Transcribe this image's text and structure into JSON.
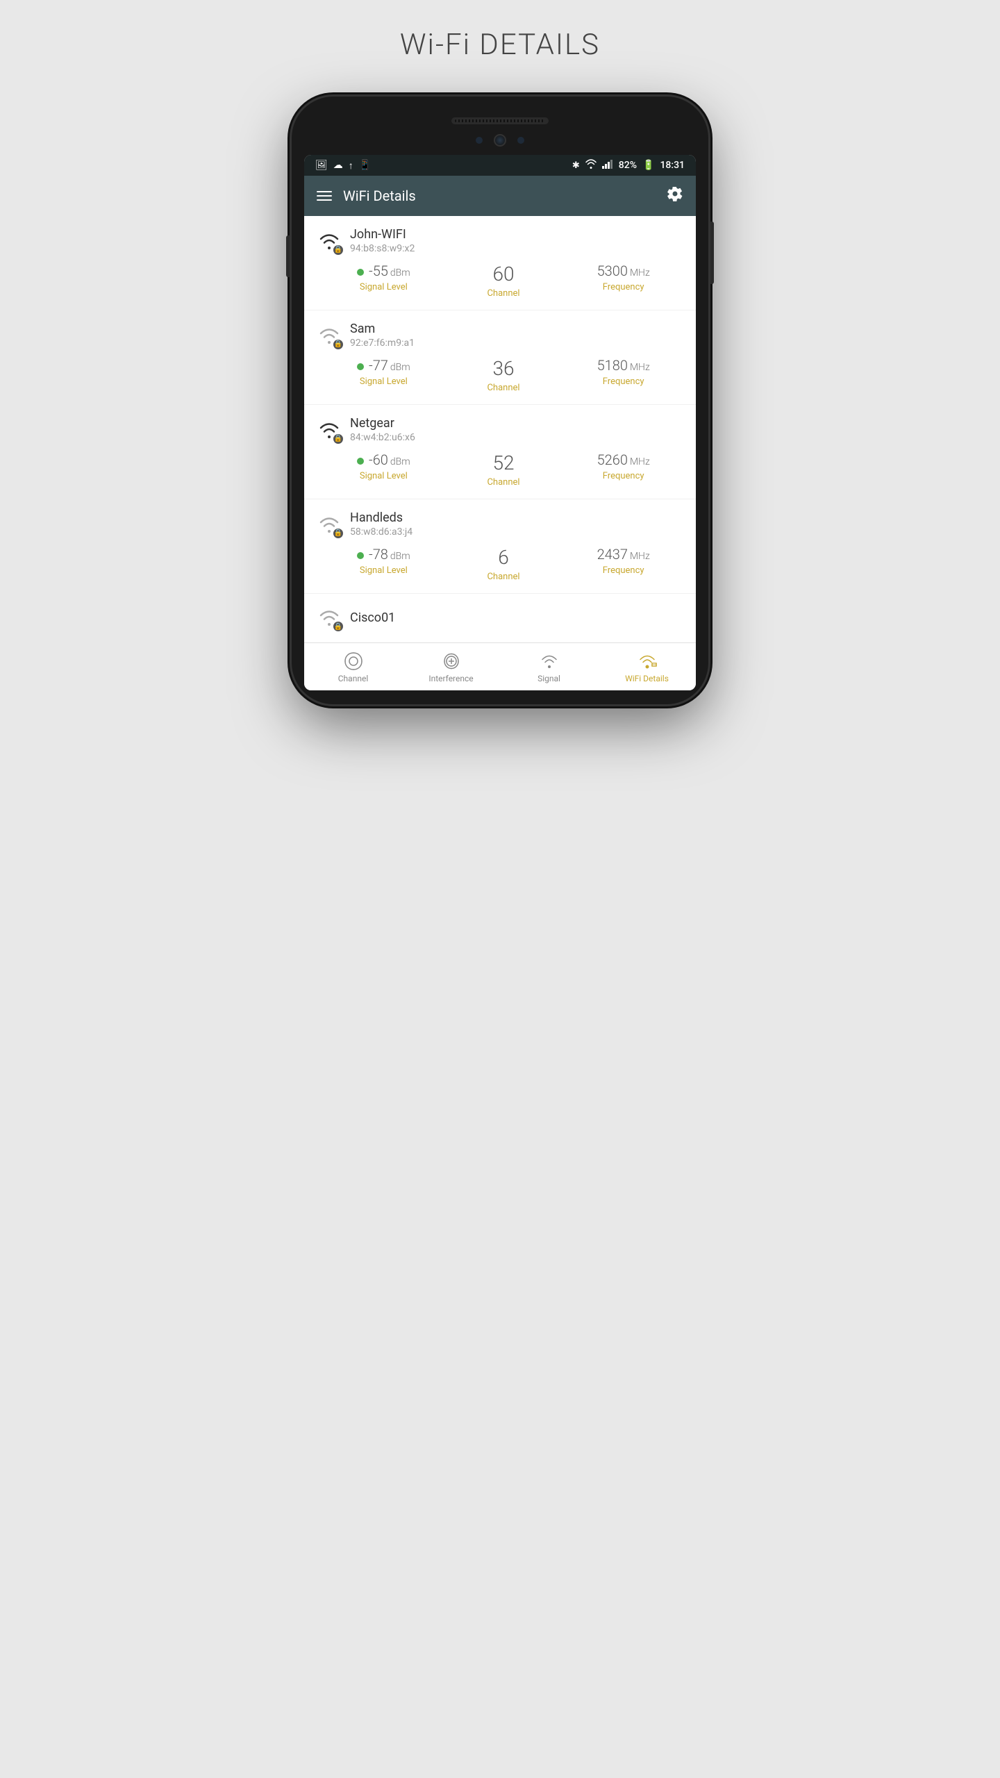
{
  "page": {
    "title": "Wi-Fi DETAILS"
  },
  "statusBar": {
    "icons_left": [
      "image",
      "cloud",
      "upload",
      "phone"
    ],
    "bluetooth": "⚡",
    "wifi": "wifi",
    "signal": "signal",
    "battery": "82%",
    "time": "18:31"
  },
  "appBar": {
    "title": "WiFi Details"
  },
  "networks": [
    {
      "name": "John-WIFI",
      "mac": "94:b8:s8:w9:x2",
      "signal": "-55",
      "signalUnit": "dBm",
      "signalLabel": "Signal Level",
      "channel": "60",
      "channelLabel": "Channel",
      "frequency": "5300",
      "frequencyUnit": "MHz",
      "frequencyLabel": "Frequency",
      "strength": "strong"
    },
    {
      "name": "Sam",
      "mac": "92:e7:f6:m9:a1",
      "signal": "-77",
      "signalUnit": "dBm",
      "signalLabel": "Signal Level",
      "channel": "36",
      "channelLabel": "Channel",
      "frequency": "5180",
      "frequencyUnit": "MHz",
      "frequencyLabel": "Frequency",
      "strength": "medium"
    },
    {
      "name": "Netgear",
      "mac": "84:w4:b2:u6:x6",
      "signal": "-60",
      "signalUnit": "dBm",
      "signalLabel": "Signal Level",
      "channel": "52",
      "channelLabel": "Channel",
      "frequency": "5260",
      "frequencyUnit": "MHz",
      "frequencyLabel": "Frequency",
      "strength": "strong"
    },
    {
      "name": "Handleds",
      "mac": "58:w8:d6:a3:j4",
      "signal": "-78",
      "signalUnit": "dBm",
      "signalLabel": "Signal Level",
      "channel": "6",
      "channelLabel": "Channel",
      "frequency": "2437",
      "frequencyUnit": "MHz",
      "frequencyLabel": "Frequency",
      "strength": "medium"
    },
    {
      "name": "Cisco01",
      "mac": "",
      "signal": "",
      "signalUnit": "",
      "signalLabel": "",
      "channel": "",
      "channelLabel": "",
      "frequency": "",
      "frequencyUnit": "",
      "frequencyLabel": "",
      "strength": "medium"
    }
  ],
  "bottomNav": {
    "items": [
      {
        "label": "Channel",
        "icon": "channel",
        "active": false
      },
      {
        "label": "Interference",
        "icon": "interference",
        "active": false
      },
      {
        "label": "Signal",
        "icon": "signal",
        "active": false
      },
      {
        "label": "WiFi Details",
        "icon": "wifi-details",
        "active": true
      }
    ]
  }
}
